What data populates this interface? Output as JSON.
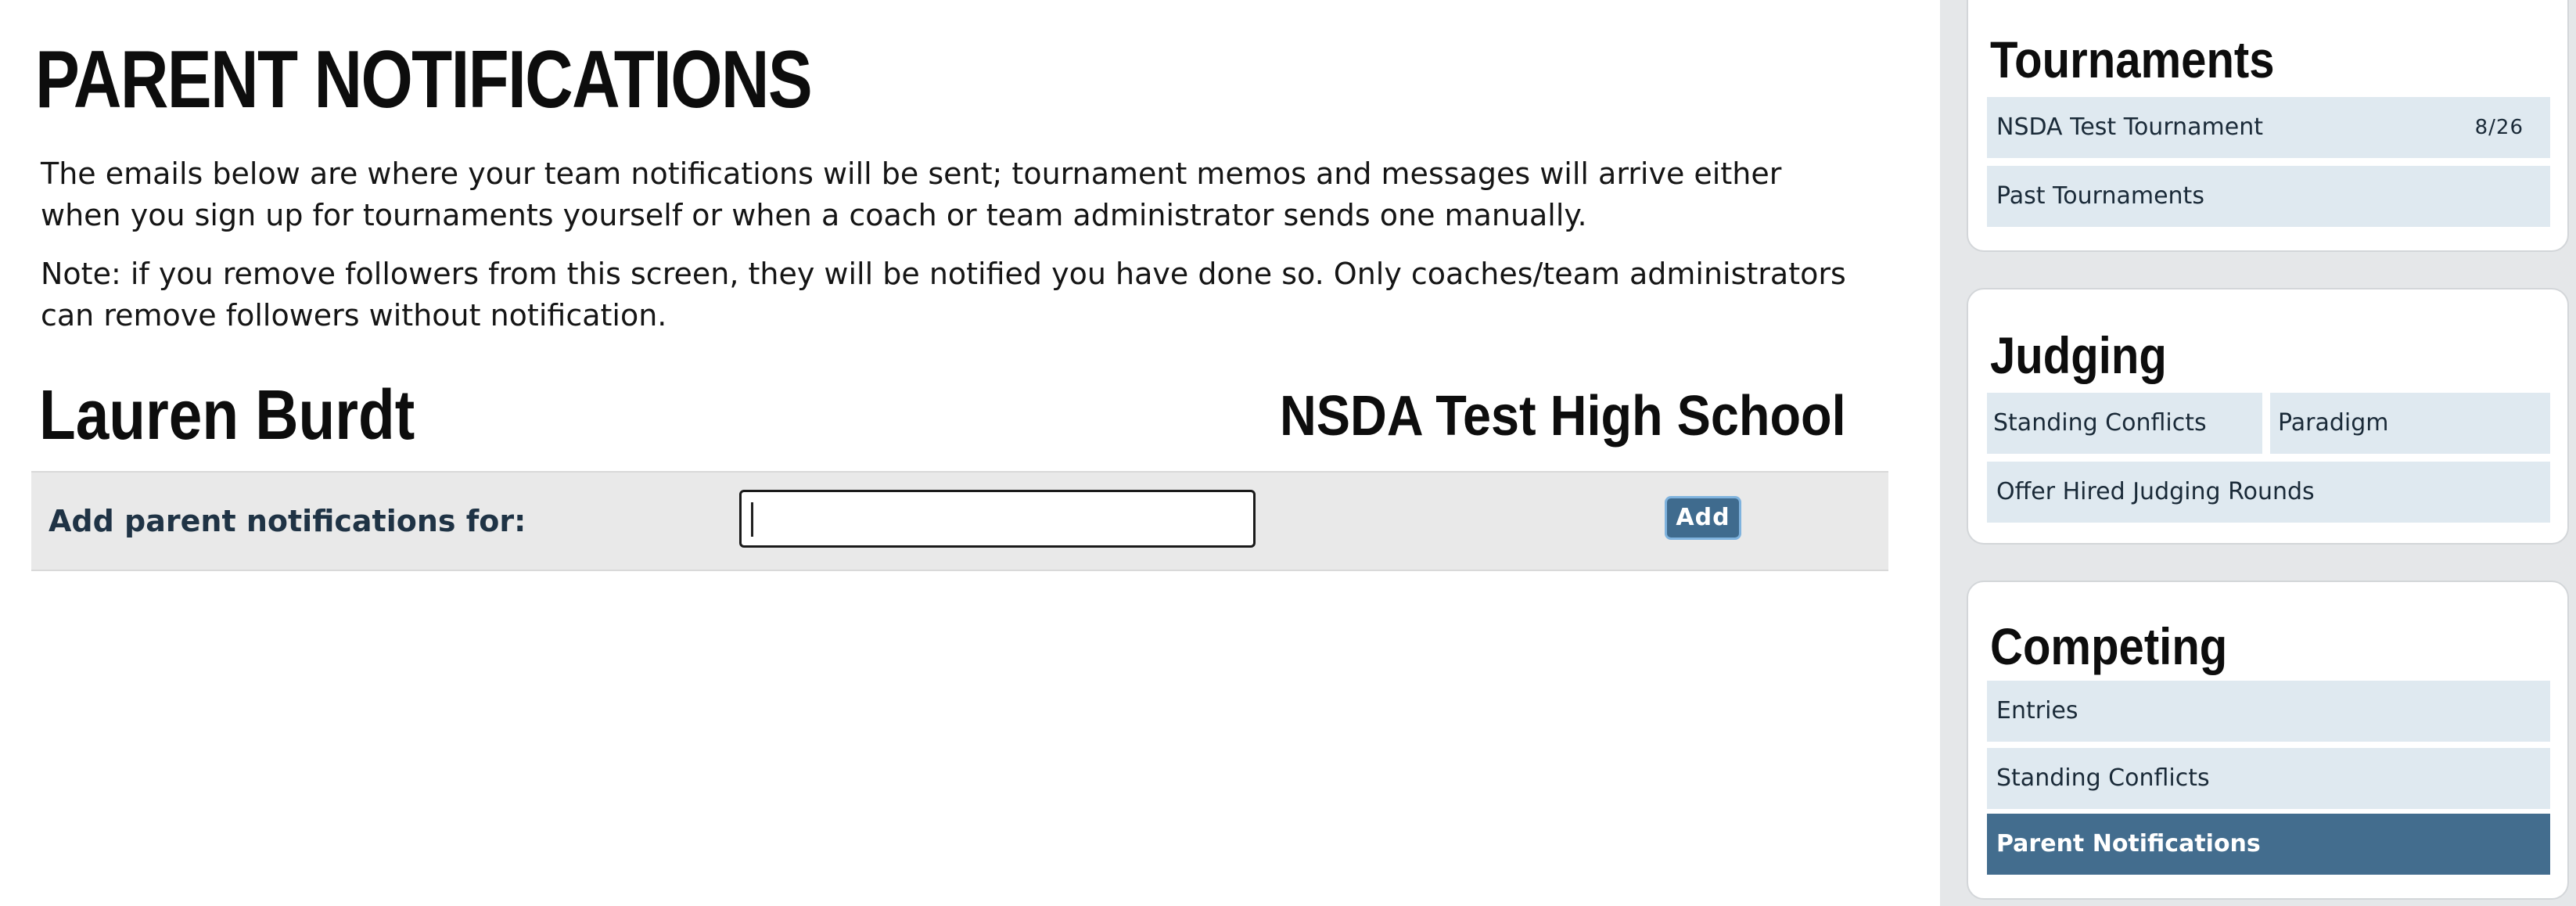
{
  "page": {
    "title": "PARENT NOTIFICATIONS",
    "intro": "The emails below are where your team notifications will be sent; tournament memos and messages will arrive either when you sign up for tournaments yourself or when a coach or team administrator sends one manually.",
    "note": "Note: if you remove followers from this screen, they will be notified you have done so. Only coaches/team administrators can remove followers without notification."
  },
  "person": {
    "name": "Lauren Burdt",
    "school": "NSDA Test High School"
  },
  "add_form": {
    "label": "Add parent notifications for:",
    "input_value": "",
    "input_placeholder": "",
    "button_label": "Add"
  },
  "sidebar": {
    "tournaments": {
      "title": "Tournaments",
      "items": [
        {
          "label": "NSDA Test Tournament",
          "badge": "8/26"
        },
        {
          "label": "Past Tournaments"
        }
      ]
    },
    "judging": {
      "title": "Judging",
      "items": [
        {
          "label": "Standing Conflicts"
        },
        {
          "label": "Paradigm"
        },
        {
          "label": "Offer Hired Judging Rounds"
        }
      ]
    },
    "competing": {
      "title": "Competing",
      "items": [
        {
          "label": "Entries"
        },
        {
          "label": "Standing Conflicts"
        },
        {
          "label": "Parent Notifications",
          "active": true
        }
      ]
    }
  },
  "colors": {
    "accent": "#436d8e",
    "sidebar_item_bg": "#dfe9f0",
    "sidebar_bg": "#e5e7e9",
    "form_row_bg": "#e9e9e9"
  }
}
